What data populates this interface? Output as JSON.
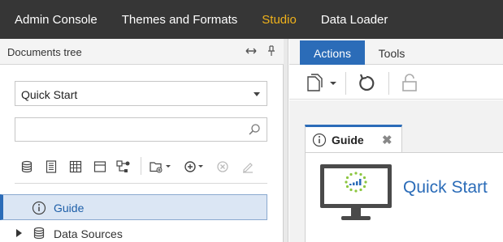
{
  "topnav": {
    "items": [
      {
        "label": "Admin Console",
        "active": false
      },
      {
        "label": "Themes and Formats",
        "active": false
      },
      {
        "label": "Studio",
        "active": true
      },
      {
        "label": "Data Loader",
        "active": false
      }
    ]
  },
  "left_panel": {
    "title": "Documents tree",
    "select": {
      "value": "Quick Start"
    },
    "search": {
      "value": "",
      "placeholder": ""
    },
    "toolbar_icons": [
      "database-icon",
      "list-icon",
      "grid-icon",
      "panel-icon",
      "flow-icon",
      "add-folder-icon",
      "add-circle-icon",
      "remove-circle-icon",
      "edit-icon"
    ],
    "tree": [
      {
        "label": "Guide",
        "icon": "info-icon",
        "selected": true
      },
      {
        "label": "Data Sources",
        "icon": "database-icon",
        "selected": false
      }
    ]
  },
  "right_panel": {
    "tabs": [
      {
        "label": "Actions",
        "active": true
      },
      {
        "label": "Tools",
        "active": false
      }
    ],
    "toolbar_icons": [
      "new-document-icon",
      "refresh-icon",
      "lock-icon"
    ],
    "doc_tab": {
      "label": "Guide",
      "icon": "info-icon"
    },
    "content_title": "Quick Start"
  },
  "colors": {
    "nav_bg": "#363636",
    "nav_active": "#f0b21b",
    "accent": "#2b6cb8",
    "selected_bg": "#dbe6f4",
    "monitor_green": "#8cc63f"
  }
}
